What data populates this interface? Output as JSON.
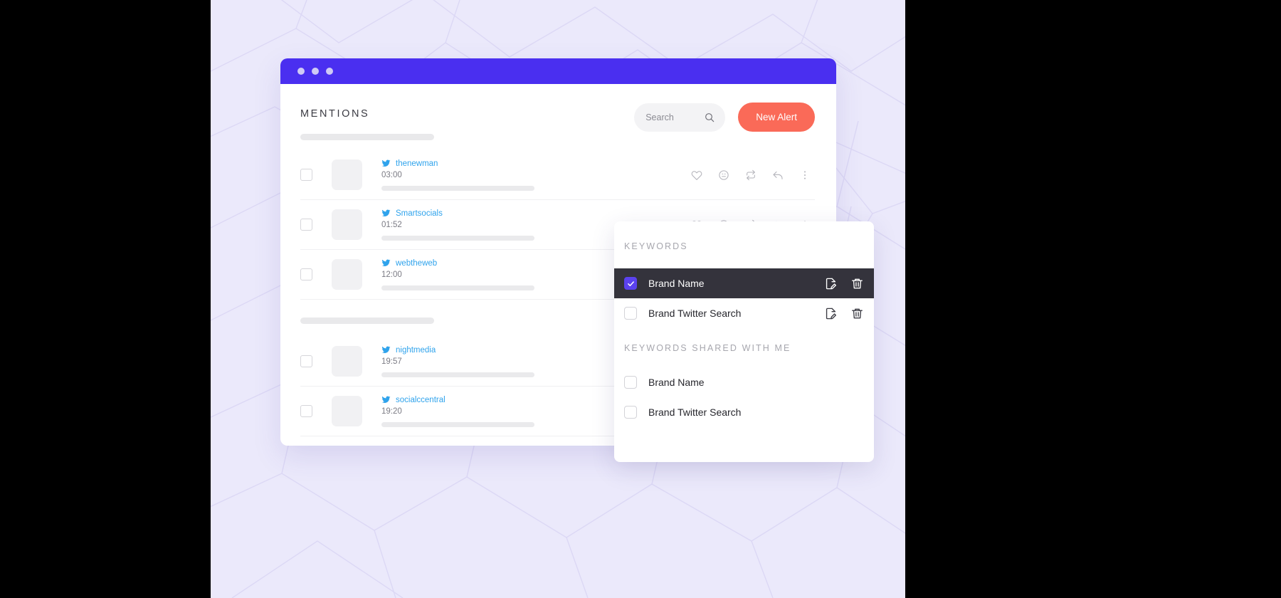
{
  "window": {
    "titlebar_dots": [
      "dot-1",
      "dot-2",
      "dot-3"
    ],
    "accent_purple": "#4a2ff0"
  },
  "header": {
    "page_title": "MENTIONS",
    "search": {
      "value": "",
      "placeholder": "Search",
      "icon": "search-icon"
    },
    "new_alert_label": "New Alert",
    "new_alert_color": "#fa6a58"
  },
  "mentions": {
    "row_action_icons": [
      "heart-icon",
      "smiley-icon",
      "retweet-icon",
      "reply-icon",
      "more-vertical-icon"
    ],
    "groups": [
      {
        "rows": [
          {
            "handle": "thenewman",
            "time": "03:00",
            "network_icon": "twitter-icon",
            "checked": false,
            "show_actions": true
          },
          {
            "handle": "Smartsocials",
            "time": "01:52",
            "network_icon": "twitter-icon",
            "checked": false,
            "show_actions": true
          },
          {
            "handle": "webtheweb",
            "time": "12:00",
            "network_icon": "twitter-icon",
            "checked": false,
            "show_actions": true
          }
        ]
      },
      {
        "rows": [
          {
            "handle": "nightmedia",
            "time": "19:57",
            "network_icon": "twitter-icon",
            "checked": false,
            "show_actions": false
          },
          {
            "handle": "socialccentral",
            "time": "19:20",
            "network_icon": "twitter-icon",
            "checked": false,
            "show_actions": false
          }
        ]
      }
    ]
  },
  "keywords_panel": {
    "section_own_title": "KEYWORDS",
    "section_shared_title": "KEYWORDS SHARED WITH ME",
    "own": [
      {
        "label": "Brand Name",
        "checked": true,
        "active": true,
        "tools": [
          "edit-icon",
          "trash-icon"
        ]
      },
      {
        "label": "Brand Twitter Search",
        "checked": false,
        "active": false,
        "tools": [
          "edit-icon",
          "trash-icon"
        ]
      }
    ],
    "shared": [
      {
        "label": "Brand Name",
        "checked": false,
        "active": false,
        "tools": []
      },
      {
        "label": "Brand Twitter Search",
        "checked": false,
        "active": false,
        "tools": []
      }
    ],
    "checkbox_accent": "#5b42ef",
    "active_row_background": "#34333c"
  }
}
